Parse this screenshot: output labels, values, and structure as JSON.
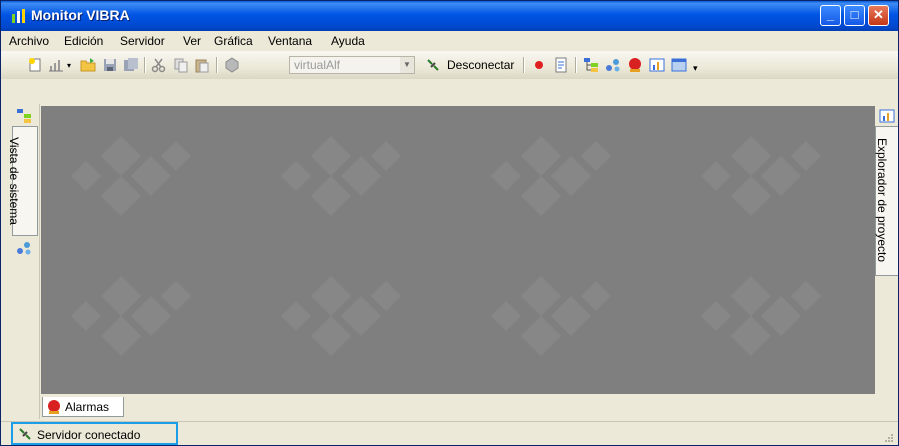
{
  "window": {
    "title": "Monitor VIBRA"
  },
  "controls": {
    "minimize": "_",
    "maximize": "□",
    "close": "✕"
  },
  "menu": {
    "items": [
      {
        "label": "Archivo"
      },
      {
        "label": "Edición"
      },
      {
        "label": "Servidor"
      },
      {
        "label": "Ver"
      },
      {
        "label": "Gráfica"
      },
      {
        "label": "Ventana"
      },
      {
        "label": "Ayuda"
      }
    ]
  },
  "toolbar": {
    "server_combo_value": "virtualAlf",
    "disconnect_label": "Desconectar"
  },
  "left_panel": {
    "tab_label": "Vista de sistema"
  },
  "right_panel": {
    "tab_label": "Explorador de proyecto"
  },
  "bottom_tabs": [
    {
      "label": "Alarmas"
    }
  ],
  "status": {
    "text": "Servidor conectado"
  },
  "colors": {
    "titlebar": "#0055e5",
    "workspace": "#7f7f7f",
    "status_highlight": "#1a9ee8",
    "chrome": "#ece9d8"
  }
}
